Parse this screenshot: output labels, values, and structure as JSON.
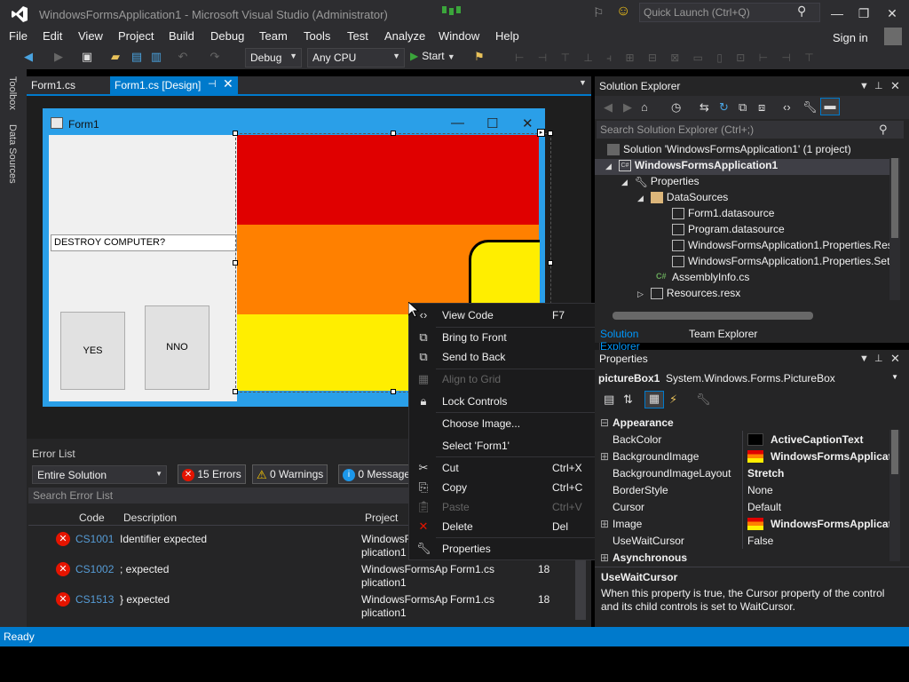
{
  "title_bar": {
    "title": "WindowsFormsApplication1 - Microsoft Visual Studio (Administrator)",
    "quick_launch": "Quick Launch (Ctrl+Q)"
  },
  "menu": [
    "File",
    "Edit",
    "View",
    "Project",
    "Build",
    "Debug",
    "Team",
    "Tools",
    "Test",
    "Analyze",
    "Window",
    "Help"
  ],
  "sign_in": "Sign in",
  "toolbar": {
    "config": "Debug",
    "platform": "Any CPU",
    "start": "Start"
  },
  "left_rail": {
    "toolbox": "Toolbox",
    "data_sources": "Data Sources"
  },
  "doc_tabs": [
    {
      "label": "Form1.cs"
    },
    {
      "label": "Form1.cs [Design]"
    }
  ],
  "designer": {
    "form_title": "Form1",
    "textbox_value": "DESTROY COMPUTER?",
    "buttons": [
      "YES",
      "NNO"
    ],
    "picturebox_colors": [
      "#e00000",
      "#ff8000",
      "#ffee00"
    ]
  },
  "context_menu": [
    {
      "icon": "view-code-icon",
      "label": "View Code",
      "key": "F7",
      "enabled": true
    },
    {
      "icon": "bring-front-icon",
      "label": "Bring to Front",
      "key": "",
      "enabled": true
    },
    {
      "icon": "send-back-icon",
      "label": "Send to Back",
      "key": "",
      "enabled": true
    },
    {
      "icon": "align-grid-icon",
      "label": "Align to Grid",
      "key": "",
      "enabled": false
    },
    {
      "icon": "lock-icon",
      "label": "Lock Controls",
      "key": "",
      "enabled": true
    },
    {
      "icon": "",
      "label": "Choose Image...",
      "key": "",
      "enabled": true
    },
    {
      "icon": "",
      "label": "Select 'Form1'",
      "key": "",
      "enabled": true
    },
    {
      "icon": "cut-icon",
      "label": "Cut",
      "key": "Ctrl+X",
      "enabled": true
    },
    {
      "icon": "copy-icon",
      "label": "Copy",
      "key": "Ctrl+C",
      "enabled": true
    },
    {
      "icon": "paste-icon",
      "label": "Paste",
      "key": "Ctrl+V",
      "enabled": false
    },
    {
      "icon": "delete-icon",
      "label": "Delete",
      "key": "Del",
      "enabled": true
    },
    {
      "icon": "wrench-icon",
      "label": "Properties",
      "key": "",
      "enabled": true
    }
  ],
  "error_list": {
    "title": "Error List",
    "scope": "Entire Solution",
    "errors_chip": "15 Errors",
    "warnings_chip": "0 Warnings",
    "messages_chip": "0 Message",
    "search_placeholder": "Search Error List",
    "columns": {
      "code": "Code",
      "description": "Description",
      "project": "Project"
    },
    "rows": [
      {
        "code": "CS1001",
        "description": "Identifier expected",
        "project": "WindowsFormsAp plication1",
        "file": "",
        "line": ""
      },
      {
        "code": "CS1002",
        "description": "; expected",
        "project": "WindowsFormsAp plication1",
        "file": "Form1.cs",
        "line": "18"
      },
      {
        "code": "CS1513",
        "description": "} expected",
        "project": "WindowsFormsAp plication1",
        "file": "Form1.cs",
        "line": "18"
      }
    ]
  },
  "solution_explorer": {
    "title": "Solution Explorer",
    "search_placeholder": "Search Solution Explorer (Ctrl+;)",
    "tree": [
      {
        "label": "Solution 'WindowsFormsApplication1' (1 project)",
        "icon": "solution-icon",
        "bold": false
      },
      {
        "label": "WindowsFormsApplication1",
        "icon": "csharp-project-icon",
        "bold": true
      },
      {
        "label": "Properties",
        "icon": "wrench-icon",
        "bold": false
      },
      {
        "label": "DataSources",
        "icon": "folder-icon",
        "bold": false
      },
      {
        "label": "Form1.datasource",
        "icon": "datasource-icon",
        "bold": false
      },
      {
        "label": "Program.datasource",
        "icon": "datasource-icon",
        "bold": false
      },
      {
        "label": "WindowsFormsApplication1.Properties.Res",
        "icon": "datasource-icon",
        "bold": false
      },
      {
        "label": "WindowsFormsApplication1.Properties.Set",
        "icon": "datasource-icon",
        "bold": false
      },
      {
        "label": "AssemblyInfo.cs",
        "icon": "csharp-file-icon",
        "bold": false
      },
      {
        "label": "Resources.resx",
        "icon": "resx-icon",
        "bold": false
      }
    ],
    "tabs": [
      "Solution Explorer",
      "Team Explorer"
    ]
  },
  "properties": {
    "title": "Properties",
    "object_name": "pictureBox1",
    "object_type": "System.Windows.Forms.PictureBox",
    "rows": [
      {
        "type": "category",
        "name": "Appearance"
      },
      {
        "type": "prop",
        "name": "BackColor",
        "value": "ActiveCaptionText",
        "swatch": "#000000",
        "bold": true
      },
      {
        "type": "prop",
        "name": "BackgroundImage",
        "value": "WindowsFormsApplicat",
        "swatch": "image",
        "bold": true,
        "expandable": true
      },
      {
        "type": "prop",
        "name": "BackgroundImageLayout",
        "value": "Stretch",
        "bold": true
      },
      {
        "type": "prop",
        "name": "BorderStyle",
        "value": "None",
        "bold": false
      },
      {
        "type": "prop",
        "name": "Cursor",
        "value": "Default",
        "bold": false
      },
      {
        "type": "prop",
        "name": "Image",
        "value": "WindowsFormsApplicat",
        "swatch": "image",
        "bold": true,
        "expandable": true
      },
      {
        "type": "prop",
        "name": "UseWaitCursor",
        "value": "False",
        "bold": false
      },
      {
        "type": "category",
        "name": "Asynchronous"
      }
    ],
    "desc_name": "UseWaitCursor",
    "desc_text": "When this property is true, the Cursor property of the control and its child controls is set to WaitCursor."
  },
  "status": "Ready",
  "colors": {
    "accent": "#007acc",
    "error": "#e51400",
    "link": "#569cd6"
  }
}
